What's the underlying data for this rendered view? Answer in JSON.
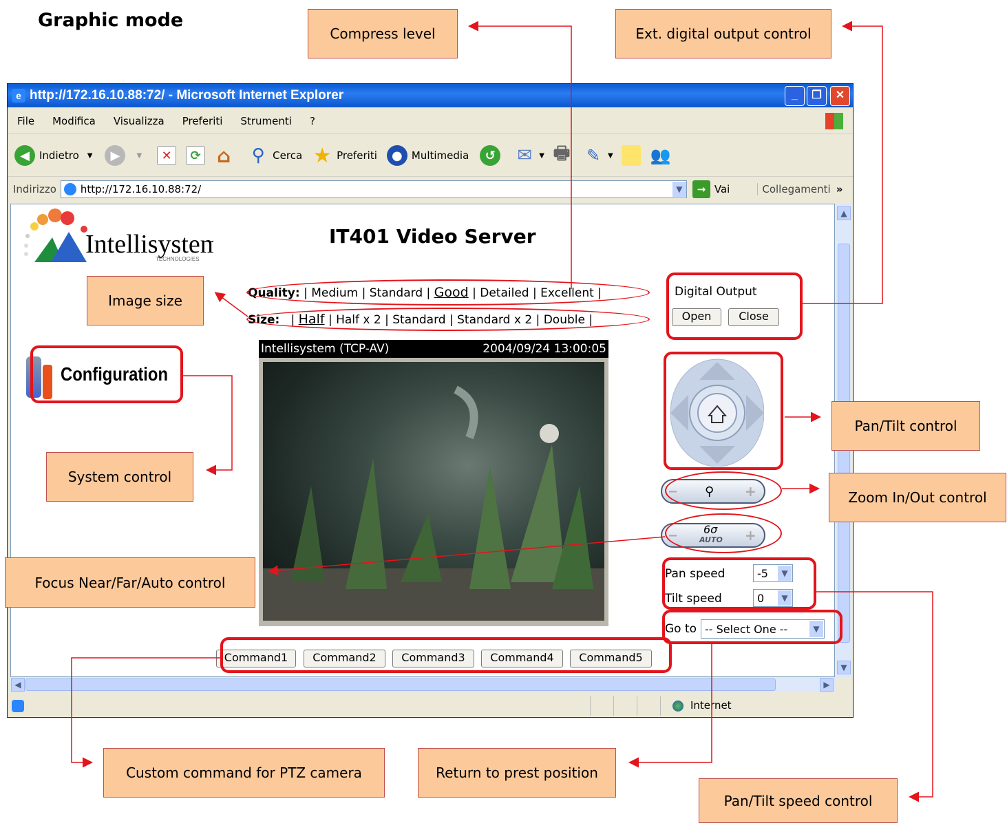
{
  "doc_title": "Graphic mode",
  "callouts": {
    "compress_level": "Compress level",
    "ext_digital_output": "Ext. digital output control",
    "image_size": "Image size",
    "system_control": "System control",
    "pan_tilt_control": "Pan/Tilt control",
    "zoom_control": "Zoom In/Out control",
    "focus_control": "Focus Near/Far/Auto control",
    "custom_command": "Custom command for PTZ camera",
    "return_preset": "Return to prest position",
    "pan_tilt_speed": "Pan/Tilt speed control"
  },
  "browser": {
    "title": "http://172.16.10.88:72/ - Microsoft Internet Explorer",
    "menu": [
      "File",
      "Modifica",
      "Visualizza",
      "Preferiti",
      "Strumenti",
      "?"
    ],
    "toolbar": {
      "back": "Indietro",
      "search": "Cerca",
      "favorites": "Preferiti",
      "media": "Multimedia"
    },
    "address_label": "Indirizzo",
    "address": "http://172.16.10.88:72/",
    "go": "Vai",
    "links": "Collegamenti",
    "status_zone": "Internet"
  },
  "page": {
    "logo_text": "Intellisystem",
    "logo_sub": "TECHNOLOGIES",
    "server_title": "IT401 Video Server",
    "quality_label": "Quality:",
    "quality_options": [
      "Medium",
      "Standard",
      "Good",
      "Detailed",
      "Excellent"
    ],
    "quality_selected": "Good",
    "size_label": "Size:",
    "size_options": [
      "Half",
      "Half x 2",
      "Standard",
      "Standard x 2",
      "Double"
    ],
    "size_selected": "Half",
    "configuration": "Configuration",
    "video_caption": "Intellisystem (TCP-AV)",
    "video_timestamp": "2004/09/24 13:00:05",
    "digital_output_label": "Digital Output",
    "open_button": "Open",
    "close_button": "Close",
    "focus_auto_label": "AUTO",
    "pan_speed_label": "Pan speed",
    "pan_speed_value": "-5",
    "tilt_speed_label": "Tilt speed",
    "tilt_speed_value": "0",
    "goto_label": "Go to",
    "goto_value": "-- Select One --",
    "commands": [
      "Command1",
      "Command2",
      "Command3",
      "Command4",
      "Command5"
    ]
  }
}
